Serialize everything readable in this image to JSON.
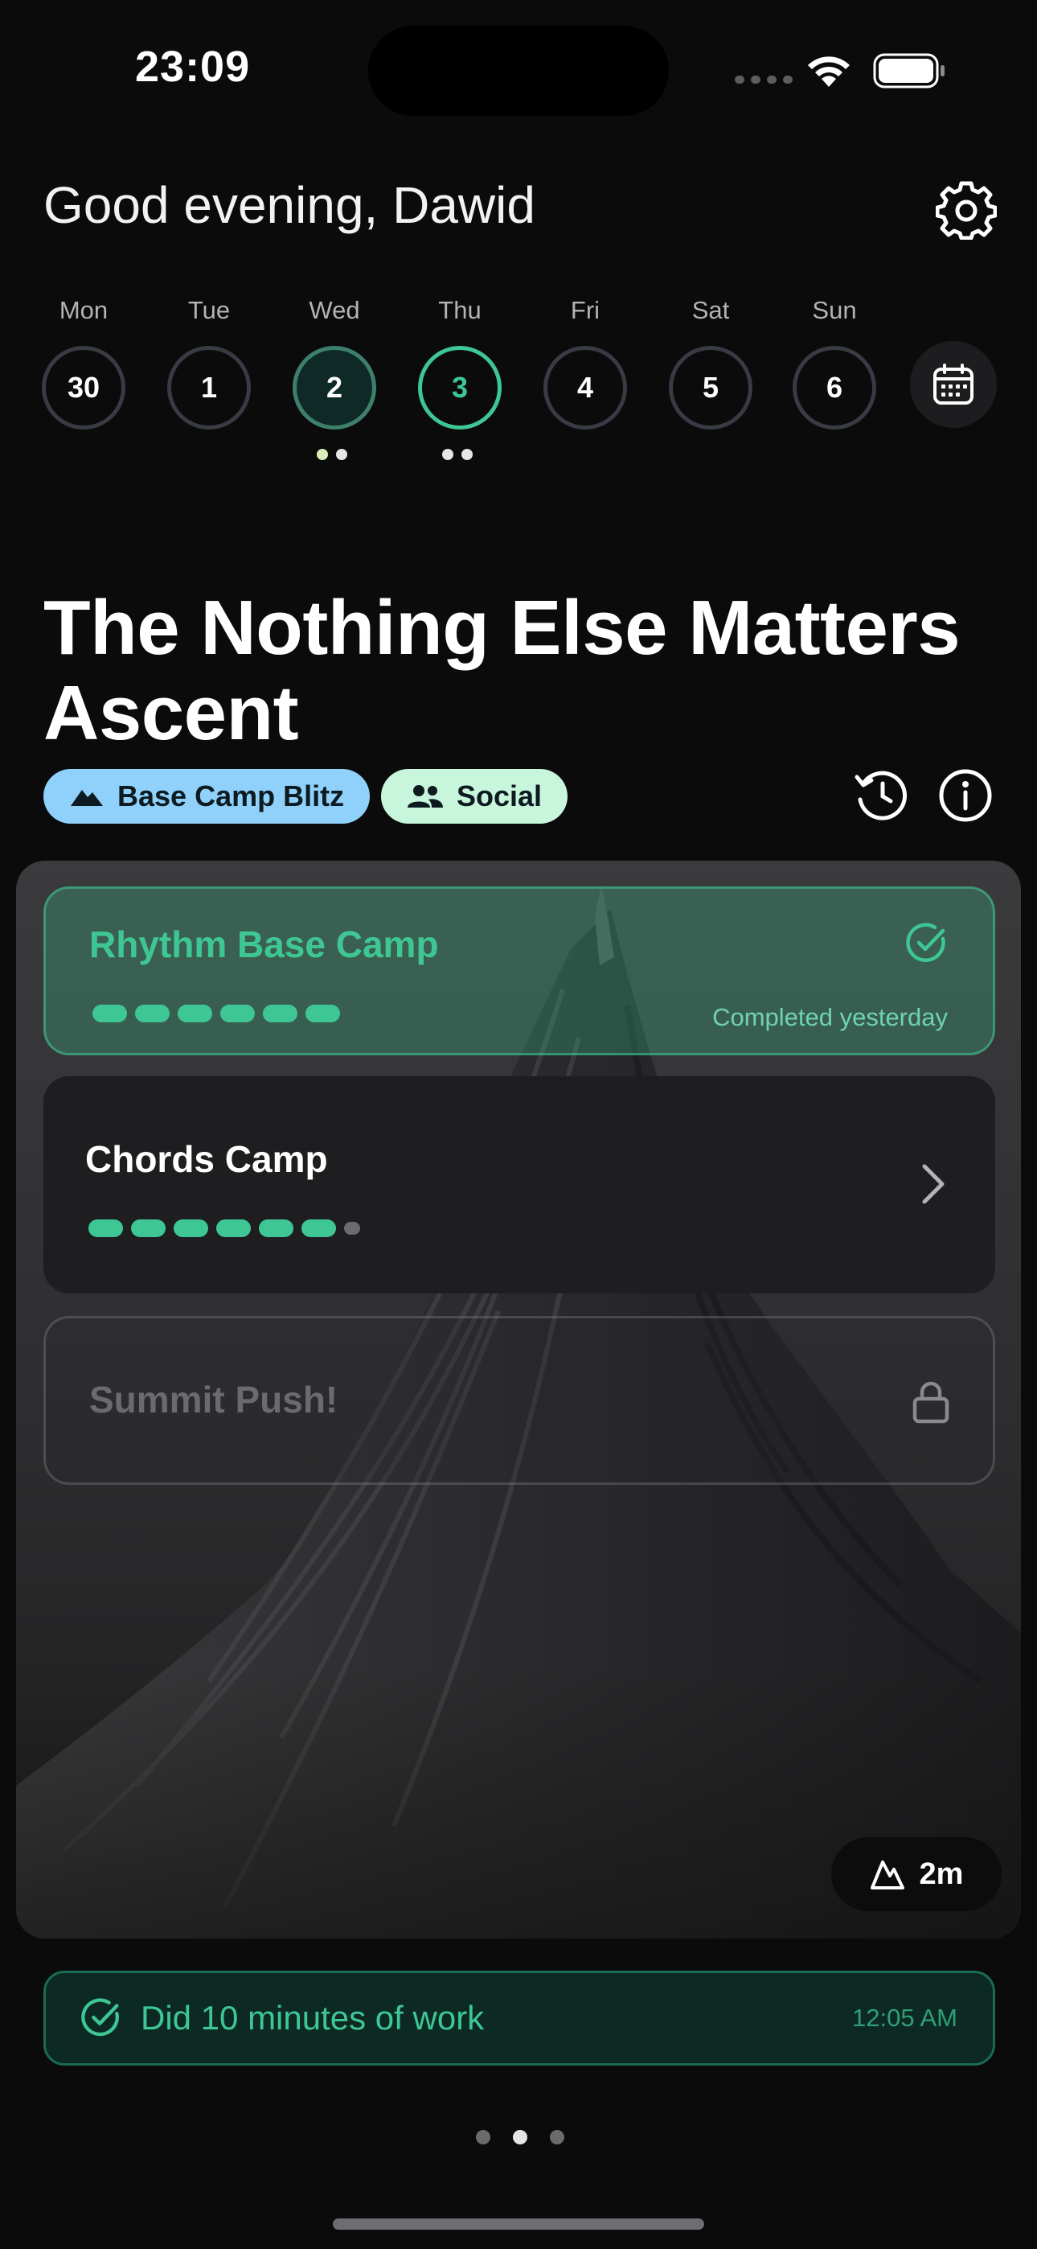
{
  "status_bar": {
    "time": "23:09"
  },
  "header": {
    "greeting": "Good evening, Dawid"
  },
  "week": {
    "days": [
      {
        "label": "Mon",
        "date": "30"
      },
      {
        "label": "Tue",
        "date": "1"
      },
      {
        "label": "Wed",
        "date": "2"
      },
      {
        "label": "Thu",
        "date": "3"
      },
      {
        "label": "Fri",
        "date": "4"
      },
      {
        "label": "Sat",
        "date": "5"
      },
      {
        "label": "Sun",
        "date": "6"
      }
    ]
  },
  "challenge": {
    "title": "The Nothing Else Matters Ascent",
    "tags": [
      {
        "label": "Base Camp Blitz",
        "icon": "mountain-icon",
        "color": "#8fd1fb"
      },
      {
        "label": "Social",
        "icon": "people-icon",
        "color": "#c7f6dd"
      }
    ]
  },
  "stages": [
    {
      "title": "Rhythm Base Camp",
      "status": "Completed yesterday",
      "progress_done": 6,
      "progress_total": 6
    },
    {
      "title": "Chords Camp",
      "progress_done": 6,
      "progress_total": 7
    },
    {
      "title": "Summit Push!",
      "locked": true
    }
  ],
  "altitude_badge": {
    "value": "2m"
  },
  "log": {
    "text": "Did 10 minutes of work",
    "time": "12:05 AM"
  },
  "colors": {
    "accent": "#3ec795",
    "background": "#0b0b0c"
  }
}
